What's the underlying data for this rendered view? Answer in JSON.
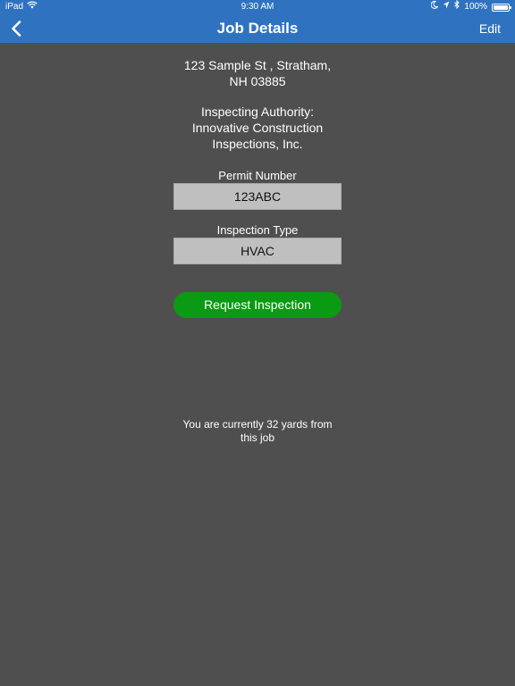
{
  "status_bar": {
    "device": "iPad",
    "time": "9:30 AM",
    "battery": "100%",
    "battery_level": 1.0
  },
  "nav": {
    "title": "Job Details",
    "edit_label": "Edit",
    "background": "#2f73c0"
  },
  "job": {
    "address_line1": "123 Sample St , Stratham,",
    "address_line2": "NH 03885",
    "authority_label": "Inspecting Authority:",
    "authority_name_line1": "Innovative Construction",
    "authority_name_line2": "Inspections, Inc.",
    "permit_label": "Permit Number",
    "permit_value": "123ABC",
    "inspection_type_label": "Inspection Type",
    "inspection_type_value": "HVAC",
    "request_button_label": "Request Inspection",
    "request_button_color": "#0b9a13",
    "distance_line1": "You are currently 32 yards from",
    "distance_line2": "this job"
  },
  "icons": {
    "back": "chevron-left-icon",
    "wifi": "wifi-icon",
    "moon": "moon-icon",
    "location": "location-arrow-icon",
    "bluetooth": "bluetooth-icon",
    "battery": "battery-icon"
  }
}
